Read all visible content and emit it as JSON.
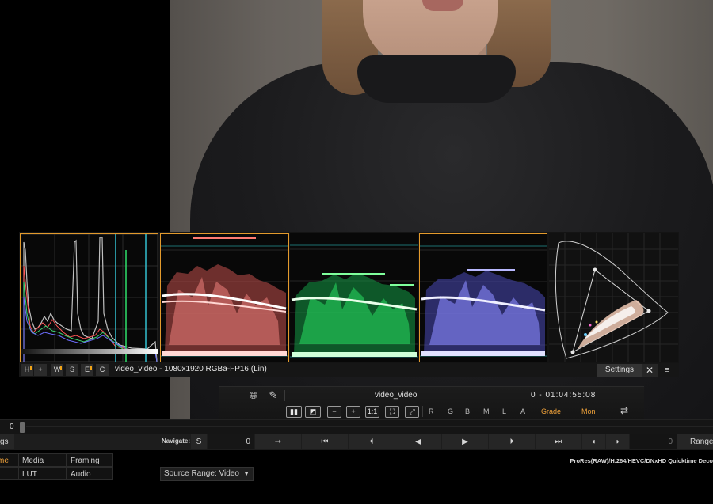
{
  "scopes": {
    "hist_buttons": [
      "H",
      "+",
      "W",
      "S",
      "E",
      "C"
    ],
    "info": "video_video - 1080x1920 RGBa-FP16 (Lin)",
    "settings_label": "Settings",
    "close_label": "✕",
    "menu_label": "≡"
  },
  "viewer_toolbar": {
    "clip_name": "video_video",
    "timecode": "0  -  01:04:55:08",
    "zoom_buttons": [
      "−",
      "+",
      "1:1",
      "⛶",
      "⤢"
    ],
    "channels": [
      "R",
      "G",
      "B",
      "M",
      "L",
      "A"
    ],
    "grade_label": "Grade",
    "mon_label": "Mon"
  },
  "timeline": {
    "frame": "0"
  },
  "navigation": {
    "left_tab": "gs",
    "label": "Navigate:",
    "s_button": "S",
    "field_value": "0",
    "frame_value": "0",
    "range_label": "Range",
    "transport": [
      "➞",
      "⏮",
      "⏴",
      "◀",
      "▶",
      "⏵",
      "⏭",
      "◖",
      "◗"
    ]
  },
  "bottom_tabs": {
    "time_tab": "me",
    "media_tab": "Media",
    "framing_tab": "Framing",
    "lut_tab": "LUT",
    "audio_tab": "Audio",
    "source_range": "Source Range: Video",
    "codecs": "ProRes(RAW)/H.264/HEVC/DNxHD Quicktime Deco"
  },
  "colors": {
    "accent": "#f0a23a",
    "red_scope": "#ff6f66",
    "green_scope": "#2fe06a",
    "blue_scope": "#7f7fff"
  }
}
